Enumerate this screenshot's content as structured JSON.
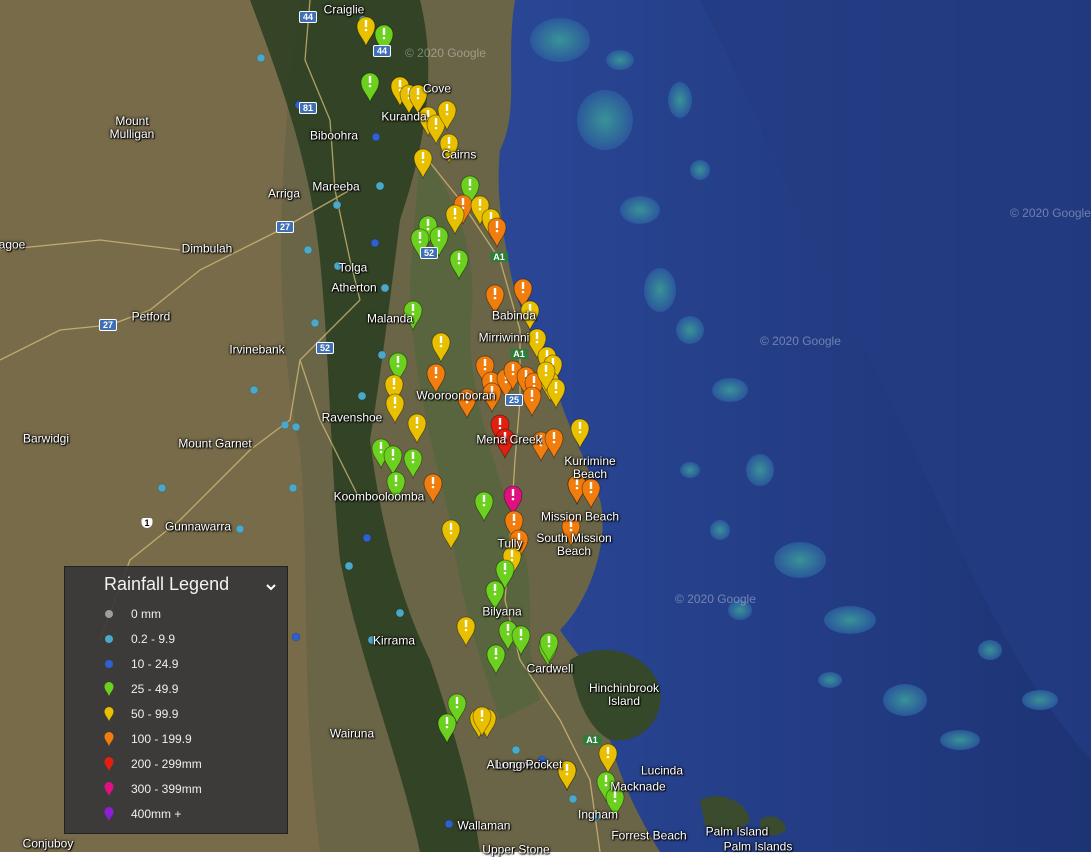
{
  "map": {
    "watermarks": [
      "© 2020 Google",
      "© 2020 Google",
      "© 2020 Google",
      "© 2020 Google"
    ],
    "places": [
      {
        "name": "Craiglie"
      },
      {
        "name": "Cove"
      },
      {
        "name": "Kuranda"
      },
      {
        "name": "Mount\nMulligan"
      },
      {
        "name": "Biboohra"
      },
      {
        "name": "Cairns"
      },
      {
        "name": "Mareeba"
      },
      {
        "name": "Arriga"
      },
      {
        "name": "agoe"
      },
      {
        "name": "Dimbulah"
      },
      {
        "name": "Tolga"
      },
      {
        "name": "Atherton"
      },
      {
        "name": "Petford"
      },
      {
        "name": "Malanda"
      },
      {
        "name": "Babinda"
      },
      {
        "name": "Irvinebank"
      },
      {
        "name": "Mirriwinni"
      },
      {
        "name": "Wooroonooran"
      },
      {
        "name": "Ravenshoe"
      },
      {
        "name": "Barwidgi"
      },
      {
        "name": "Mount Garnet"
      },
      {
        "name": "Kurrimine\nBeach"
      },
      {
        "name": "Mena Creek"
      },
      {
        "name": "Koombooloomba"
      },
      {
        "name": "Mission Beach"
      },
      {
        "name": "South Mission\nBeach"
      },
      {
        "name": "Gunnawarra"
      },
      {
        "name": "Tully"
      },
      {
        "name": "Bilyana"
      },
      {
        "name": "Kirrama"
      },
      {
        "name": "Cardwell"
      },
      {
        "name": "Hinchinbrook\nIsland"
      },
      {
        "name": "Wairuna"
      },
      {
        "name": "Abergowrie"
      },
      {
        "name": "Long Pocket"
      },
      {
        "name": "Lucinda"
      },
      {
        "name": "Macknade"
      },
      {
        "name": "Ingham"
      },
      {
        "name": "Palm Island"
      },
      {
        "name": "Forrest Beach"
      },
      {
        "name": "Wallaman"
      },
      {
        "name": "Palm Islands"
      },
      {
        "name": "Conjuboy"
      },
      {
        "name": "Upper Stone"
      }
    ],
    "roads": [
      "44",
      "44",
      "81",
      "27",
      "52",
      "A1",
      "27",
      "52",
      "A1",
      "25",
      "1",
      "A1"
    ],
    "rain_markers": [
      {
        "cls": "25-49.9"
      },
      {
        "cls": "50-99.9"
      },
      {
        "cls": "25-49.9"
      },
      {
        "cls": "50-99.9"
      },
      {
        "cls": "50-99.9"
      },
      {
        "cls": "50-99.9"
      },
      {
        "cls": "50-99.9"
      },
      {
        "cls": "50-99.9"
      },
      {
        "cls": "50-99.9"
      },
      {
        "cls": "50-99.9"
      },
      {
        "cls": "50-99.9"
      },
      {
        "cls": "25-49.9"
      },
      {
        "cls": "100-199.9"
      },
      {
        "cls": "50-99.9"
      },
      {
        "cls": "50-99.9"
      },
      {
        "cls": "50-99.9"
      },
      {
        "cls": "100-199.9"
      },
      {
        "cls": "25-49.9"
      },
      {
        "cls": "25-49.9"
      },
      {
        "cls": "25-49.9"
      },
      {
        "cls": "25-49.9"
      },
      {
        "cls": "25-49.9"
      },
      {
        "cls": "100-199.9"
      },
      {
        "cls": "100-199.9"
      },
      {
        "cls": "50-99.9"
      },
      {
        "cls": "25-49.9"
      },
      {
        "cls": "50-99.9"
      },
      {
        "cls": "50-99.9"
      },
      {
        "cls": "50-99.9"
      },
      {
        "cls": "50-99.9"
      },
      {
        "cls": "100-199.9"
      },
      {
        "cls": "100-199.9"
      },
      {
        "cls": "100-199.9"
      },
      {
        "cls": "100-199.9"
      },
      {
        "cls": "100-199.9"
      },
      {
        "cls": "100-199.9"
      },
      {
        "cls": "100-199.9"
      },
      {
        "cls": "100-199.9"
      },
      {
        "cls": "50-99.9"
      },
      {
        "cls": "50-99.9"
      },
      {
        "cls": "50-99.9"
      },
      {
        "cls": "50-99.9"
      },
      {
        "cls": "100-199.9"
      },
      {
        "cls": "100-199.9"
      },
      {
        "cls": "50-99.9"
      },
      {
        "cls": "50-99.9"
      },
      {
        "cls": "200-299mm"
      },
      {
        "cls": "200-299mm"
      },
      {
        "cls": "100-199.9"
      },
      {
        "cls": "100-199.9"
      },
      {
        "cls": "50-99.9"
      },
      {
        "cls": "25-49.9"
      },
      {
        "cls": "25-49.9"
      },
      {
        "cls": "25-49.9"
      },
      {
        "cls": "25-49.9"
      },
      {
        "cls": "100-199.9"
      },
      {
        "cls": "25-49.9"
      },
      {
        "cls": "300-399mm"
      },
      {
        "cls": "100-199.9"
      },
      {
        "cls": "100-199.9"
      },
      {
        "cls": "50-99.9"
      },
      {
        "cls": "100-199.9"
      },
      {
        "cls": "100-199.9"
      },
      {
        "cls": "50-99.9"
      },
      {
        "cls": "25-49.9"
      },
      {
        "cls": "25-49.9"
      },
      {
        "cls": "50-99.9"
      },
      {
        "cls": "25-49.9"
      },
      {
        "cls": "25-49.9"
      },
      {
        "cls": "25-49.9"
      },
      {
        "cls": "25-49.9"
      },
      {
        "cls": "25-49.9"
      },
      {
        "cls": "25-49.9"
      },
      {
        "cls": "50-99.9"
      },
      {
        "cls": "50-99.9"
      },
      {
        "cls": "50-99.9"
      },
      {
        "cls": "50-99.9"
      },
      {
        "cls": "25-49.9"
      },
      {
        "cls": "25-49.9"
      },
      {
        "cls": "100-199.9"
      },
      {
        "cls": "100-199.9"
      },
      {
        "cls": "50-99.9"
      },
      {
        "cls": "50-99.9"
      },
      {
        "cls": "25-49.9"
      }
    ]
  },
  "legend": {
    "title": "Rainfall Legend",
    "toggle_icon": "chevron-down-icon",
    "items": [
      {
        "label": "0 mm",
        "icon": "dot",
        "color": "#9e9e9e"
      },
      {
        "label": "0.2 - 9.9",
        "icon": "dot",
        "color": "#4aa8c9"
      },
      {
        "label": "10 - 24.9",
        "icon": "dot",
        "color": "#2f5fd0"
      },
      {
        "label": "25 - 49.9",
        "icon": "pin",
        "color": "#6cd11e"
      },
      {
        "label": "50 - 99.9",
        "icon": "pin",
        "color": "#e8c000"
      },
      {
        "label": "100 - 199.9",
        "icon": "pin",
        "color": "#f07d0d"
      },
      {
        "label": "200 - 299mm",
        "icon": "pin",
        "color": "#e3200f"
      },
      {
        "label": "300 - 399mm",
        "icon": "pin",
        "color": "#e0117f"
      },
      {
        "label": "400mm +",
        "icon": "pin",
        "color": "#8f1fd6"
      }
    ]
  }
}
